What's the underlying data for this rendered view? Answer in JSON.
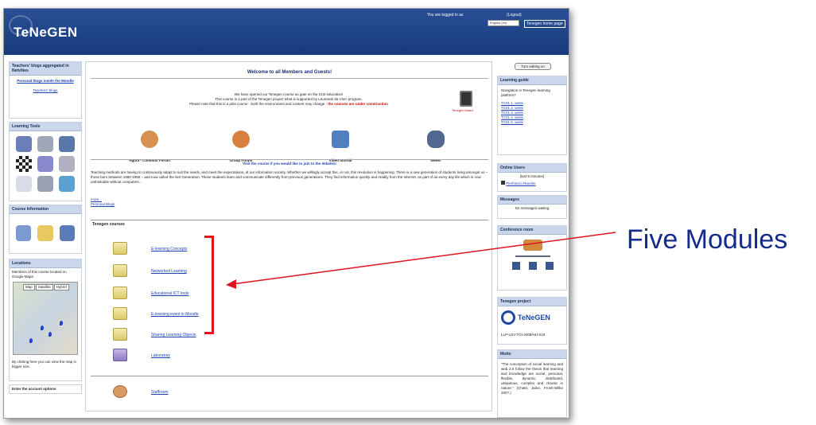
{
  "header": {
    "logo_text": "TeNeGEN",
    "login_text": "You are logged in as",
    "logout_text": "(Logout)",
    "language": "English (en)",
    "home_link": "Tenegen home page"
  },
  "left": {
    "blogs_title": "Teachers' blogs aggregated in Netvibes",
    "blogs_link": "Personal blogs inside the Moodle",
    "blogs_sub": "Teachers' blogs",
    "tools_title": "Learning Tools",
    "course_info_title": "Course Information",
    "locations_title": "Locations",
    "locations_text": "Members of this course located on Google Maps:",
    "map_tabs": [
      "Map",
      "Satellite",
      "Hybrid"
    ],
    "map_note": "By clicking here you can view the map in bigger size.",
    "bottom_title": "Enter the account options"
  },
  "main": {
    "welcome": "Welcome to all Members and Guests!",
    "intro_1": "We have opened our Tenegen course as gate on the 21st education!",
    "intro_2": "This course is a part of the Tenegen project what is supported by Leonardo da Vinci program.",
    "intro_3": "Please note that this is a pilot course - both the environment and content may change -",
    "intro_construction": "the courses are under construction",
    "news_label": "Tenegen board",
    "features": [
      {
        "label": "Agora - Common Forum"
      },
      {
        "label": "Group Forum"
      },
      {
        "label": "Video tutorial"
      },
      {
        "label": "News!"
      }
    ],
    "join_text": "Visit the course if you would like to join to the debates!",
    "paragraph": "Teaching methods are having to continuously adapt to suit the needs, and meet the expectations, of our information society. Whether we willingly accept this, or not, this revolution is happening. There is a new generation of students living amongst us – those born between 1980-1990 – and now called the Net Generation. These students learn and communicate differently from previous generations. They find information quickly and readily from the Internet, as part of an every day life which is now unthinkable without computers...",
    "more_link": "more...",
    "personal_blogs": "Personal Blogs",
    "courses_title": "Tenegen courses",
    "courses": [
      "E-learning Concepts",
      "Networked Learning",
      "Educational ICT tools",
      "E-learning event in Moodle",
      "Sharing Learning Objects",
      "Laboratory"
    ],
    "staffroom": "Staffroom"
  },
  "right": {
    "edit_button": "Turn editing on",
    "guide_title": "Learning guide",
    "guide_text": "Navigation in Tenegen learning platform?",
    "guide_links": [
      "TC01 1. week",
      "TC01 2. week",
      "TC01 3. week",
      "TC01 4. week",
      "TC01 5. week"
    ],
    "online_title": "Online Users",
    "online_period": "(last 5 minutes)",
    "online_user": "Pierfranco Ravotto",
    "messages_title": "Messages",
    "messages_text": "No messages waiting",
    "conf_title": "Conference room",
    "project_title": "Tenegen project",
    "project_logo": "TeNeGEN",
    "project_code": "LLP-LDV-TOI-2008/HU-016",
    "motto_title": "Motto",
    "motto_text": "\"The conception of social learning and web 2.0 follow the thesis that learning and knowledge are social, personal, flexible, dynamic, distributed, ubiquitous, complex and chaotic in nature.\" (Chatti, Jarke, Frosh-Wilke 2007.)"
  },
  "annotation": {
    "callout": "Five Modules",
    "color": "#e0141e"
  }
}
